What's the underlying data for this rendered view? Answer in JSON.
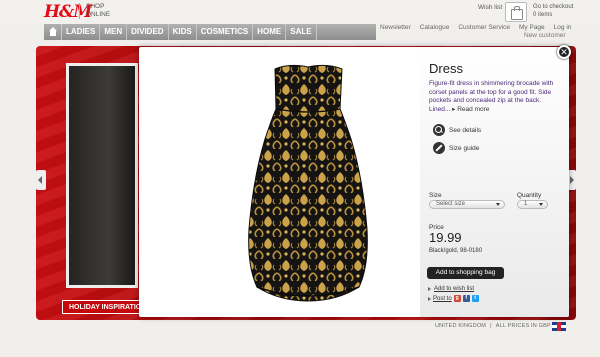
{
  "header": {
    "logo": "H&M",
    "shop_online": "SHOP ONLINE",
    "wish_list": "Wish list",
    "checkout": "Go to checkout",
    "items": "0 items"
  },
  "nav": {
    "items": [
      "LADIES",
      "MEN",
      "DIVIDED",
      "KIDS",
      "COSMETICS",
      "HOME",
      "SALE"
    ]
  },
  "util_links": [
    "Newsletter",
    "Catalogue",
    "Customer Service",
    "My Page",
    "Log in"
  ],
  "new_customer": "New customer",
  "banner": {
    "label": "HOLIDAY INSPIRATIO"
  },
  "product": {
    "title": "Dress",
    "description": "Figure-fit dress in shimmering brocade with corset panels at the top for a good fit. Side pockets and concealed zip at the back. Lined...",
    "read_more": "Read more",
    "see_details": "See details",
    "size_guide": "Size guide",
    "size_label": "Size",
    "size_value": "Select size",
    "quantity_label": "Quantity",
    "quantity_value": "1",
    "price_label": "Price",
    "price": "19.99",
    "color_code": "Black/gold, 98-0180",
    "add_to_bag": "Add to shopping bag",
    "add_to_wish": "Add to wish list",
    "post_to": "Post to"
  },
  "footer": {
    "country": "UNITED KINGDOM",
    "separator": "|",
    "currency": "ALL PRICES IN GBP"
  },
  "colors": {
    "brand_red": "#e30b17",
    "description_purple": "#4a2a7a",
    "dress_black": "#151412",
    "dress_gold": "#c9a24a"
  }
}
